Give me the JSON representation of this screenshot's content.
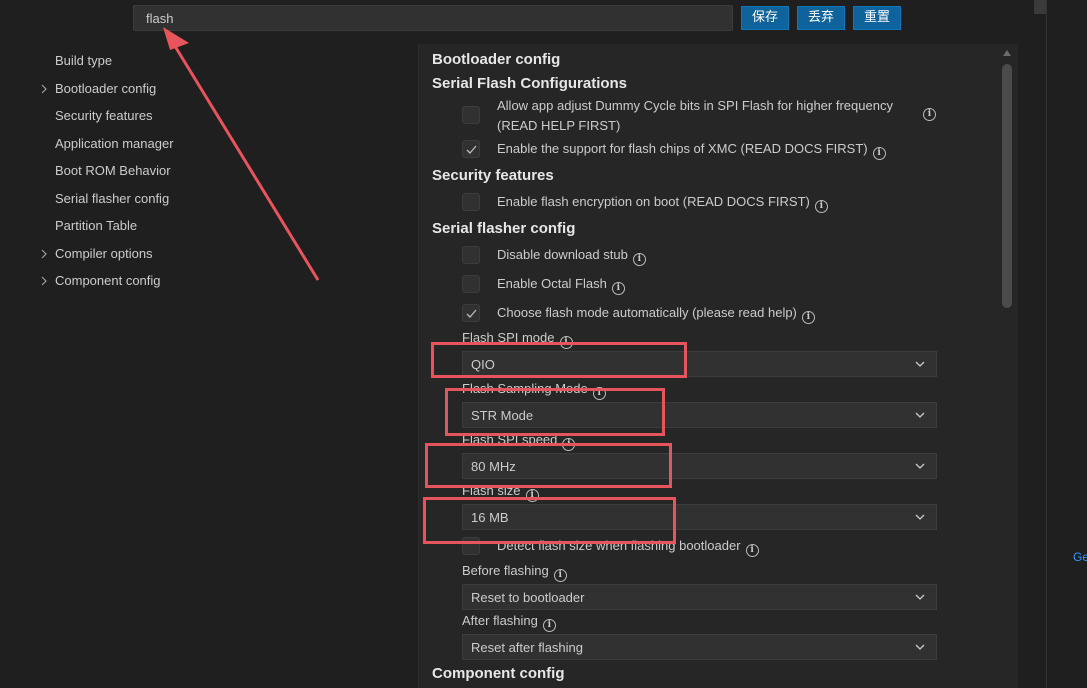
{
  "search": {
    "value": "flash"
  },
  "toolbar": {
    "save_label": "保存",
    "discard_label": "丢弃",
    "reset_label": "重置"
  },
  "nav": {
    "items": [
      {
        "label": "Build type",
        "expandable": false
      },
      {
        "label": "Bootloader config",
        "expandable": true
      },
      {
        "label": "Security features",
        "expandable": false
      },
      {
        "label": "Application manager",
        "expandable": false
      },
      {
        "label": "Boot ROM Behavior",
        "expandable": false
      },
      {
        "label": "Serial flasher config",
        "expandable": false
      },
      {
        "label": "Partition Table",
        "expandable": false
      },
      {
        "label": "Compiler options",
        "expandable": true
      },
      {
        "label": "Component config",
        "expandable": true
      }
    ]
  },
  "content": {
    "bootloader_title": "Bootloader config",
    "serial_flash_title": "Serial Flash Configurations",
    "opt_dummy_line1": "Allow app adjust Dummy Cycle bits in SPI Flash for higher frequency",
    "opt_dummy_line2": "(READ HELP FIRST)",
    "opt_xmc": "Enable the support for flash chips of XMC (READ DOCS FIRST)",
    "security_title": "Security features",
    "opt_encryption": "Enable flash encryption on boot (READ DOCS FIRST)",
    "flasher_title": "Serial flasher config",
    "opt_disable_stub": "Disable download stub",
    "opt_octal": "Enable Octal Flash",
    "opt_auto_mode": "Choose flash mode automatically (please read help)",
    "spi_mode_label": "Flash SPI mode",
    "spi_mode_value": "QIO",
    "sampling_label": "Flash Sampling Mode",
    "sampling_value": "STR Mode",
    "speed_label": "Flash SPI speed",
    "speed_value": "80 MHz",
    "size_label": "Flash size",
    "size_value": "16 MB",
    "opt_detect_size": "Detect flash size when flashing bootloader",
    "before_label": "Before flashing",
    "before_value": "Reset to bootloader",
    "after_label": "After flashing",
    "after_value": "Reset after flashing",
    "component_title": "Component config"
  },
  "checkbox_states": {
    "dummy": false,
    "xmc": true,
    "encryption": false,
    "disable_stub": false,
    "octal": false,
    "auto_mode": true,
    "detect_size": false
  },
  "edge_text": "Ge",
  "colors": {
    "accent": "#0e639c",
    "annotation": "#e8545b",
    "background": "#1f1f1f",
    "panel": "#262626"
  }
}
